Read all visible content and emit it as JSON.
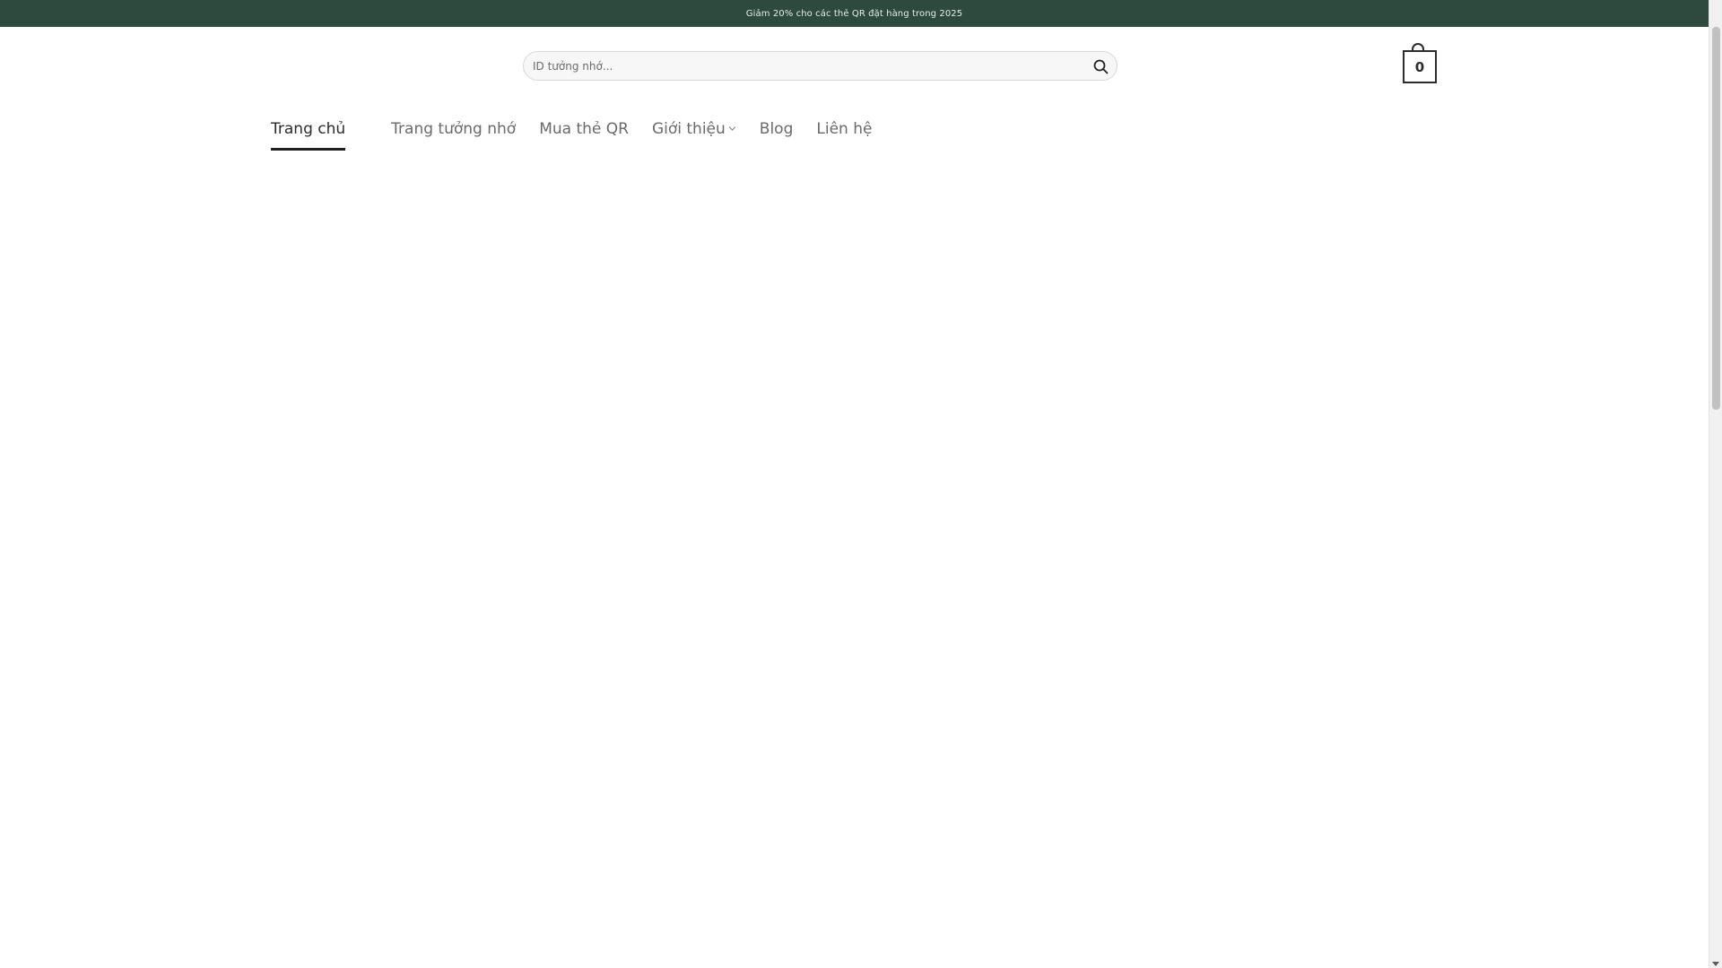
{
  "announcement": {
    "text": "Giảm 20% cho các thẻ QR đặt hàng trong 2025"
  },
  "search": {
    "placeholder": "ID tưởng nhớ..."
  },
  "cart": {
    "count": "0"
  },
  "nav": {
    "items": [
      {
        "label": "Trang chủ",
        "active": true
      },
      {
        "label": "Trang tưởng nhớ",
        "active": false
      },
      {
        "label": "Mua thẻ QR",
        "active": false
      },
      {
        "label": "Giới thiệu",
        "active": false,
        "has_dropdown": true
      },
      {
        "label": "Blog",
        "active": false
      },
      {
        "label": "Liên hệ",
        "active": false
      }
    ]
  },
  "colors": {
    "top_bar": "#2c4a3e",
    "active_underline": "#1f1f1f"
  }
}
